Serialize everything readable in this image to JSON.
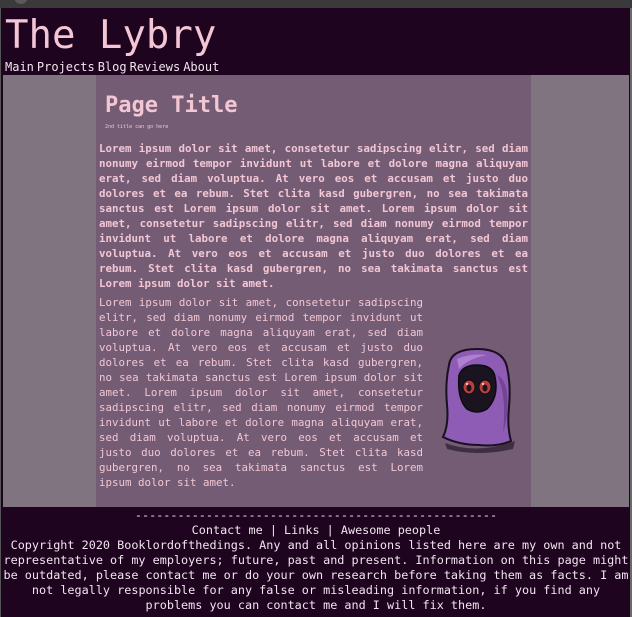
{
  "site": {
    "title": "The Lybry"
  },
  "nav": {
    "items": [
      "Main",
      "Projects",
      "Blog",
      "Reviews",
      "About"
    ]
  },
  "main": {
    "page_title": "Page Title",
    "subtitle": "2nd title can go here",
    "para_bold": "Lorem ipsum dolor sit amet, consetetur sadipscing elitr, sed diam nonumy eirmod tempor invidunt ut labore et dolore magna aliquyam erat, sed diam voluptua. At vero eos et accusam et justo duo dolores et ea rebum. Stet clita kasd gubergren, no sea takimata sanctus est Lorem ipsum dolor sit amet. Lorem ipsum dolor sit amet, consetetur sadipscing elitr, sed diam nonumy eirmod tempor invidunt ut labore et dolore magna aliquyam erat, sed diam voluptua. At vero eos et accusam et justo duo dolores et ea rebum. Stet clita kasd gubergren, no sea takimata sanctus est Lorem ipsum dolor sit amet.",
    "para_normal": "Lorem ipsum dolor sit amet, consetetur sadipscing elitr, sed diam nonumy eirmod tempor invidunt ut labore et dolore magna aliquyam erat, sed diam voluptua. At vero eos et accusam et justo duo dolores et ea rebum. Stet clita kasd gubergren, no sea takimata sanctus est Lorem ipsum dolor sit amet. Lorem ipsum dolor sit amet, consetetur sadipscing elitr, sed diam nonumy eirmod tempor invidunt ut labore et dolore magna aliquyam erat, sed diam voluptua. At vero eos et accusam et justo duo dolores et ea rebum. Stet clita kasd gubergren, no sea takimata sanctus est Lorem ipsum dolor sit amet."
  },
  "footer": {
    "divider": "---------------------------------------------------",
    "links": [
      "Contact me",
      "Links",
      "Awesome people"
    ],
    "separator": "|",
    "copyright": "Copyright 2020 Booklordofthedings. Any and all opinions listed here are my own and not representative of my employers; future, past and present. Information on this page might be outdated, please contact me or do your own research before taking them as facts. I am not legally responsible for any false or misleading information, if you find any problems you can contact me and I will fix them."
  },
  "colors": {
    "header_bg": "#1f0420",
    "title_pink": "#f2c6d4",
    "content_bg": "#745d74",
    "side_bg": "#807480",
    "character_purple": "#8e5bb5"
  },
  "icons": {
    "illustration": "hooded-character-icon"
  }
}
